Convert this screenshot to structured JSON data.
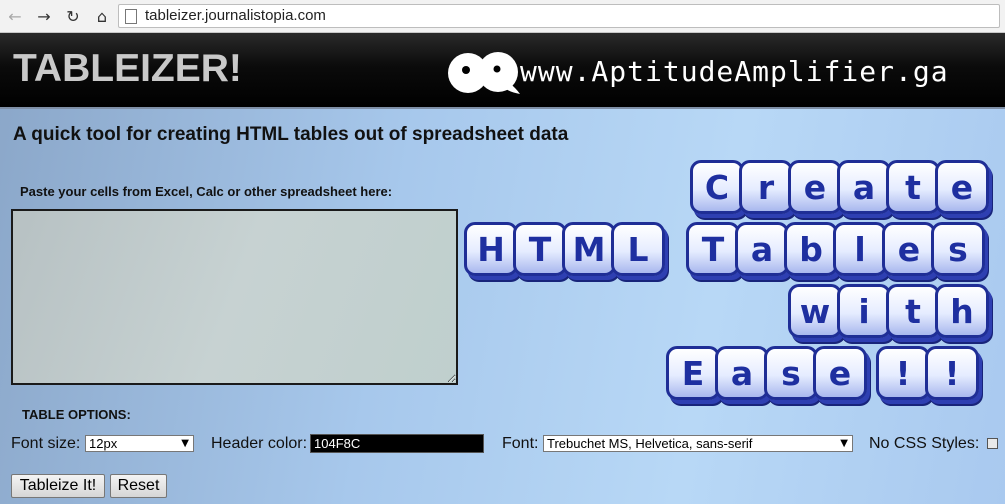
{
  "browser": {
    "url": "tableizer.journalistopia.com",
    "back_icon": "back-arrow-icon",
    "forward_icon": "forward-arrow-icon",
    "reload_icon": "reload-icon",
    "home_icon": "home-icon"
  },
  "header": {
    "title": "TABLEIZER!",
    "brand_url": "www.AptitudeAmplifier.ga",
    "logo_icon": "double-eye-logo-icon"
  },
  "main": {
    "heading": "A quick tool for creating HTML tables out of spreadsheet data",
    "paste_label": "Paste your cells from Excel, Calc or other spreadsheet here:",
    "paste_value": ""
  },
  "options": {
    "heading": "TABLE OPTIONS:",
    "font_size_label": "Font size:",
    "font_size_value": "12px",
    "header_color_label": "Header color:",
    "header_color_value": "104F8C",
    "font_label": "Font:",
    "font_value": "Trebuchet MS, Helvetica, sans-serif",
    "no_css_label": "No CSS Styles:",
    "no_css_checked": false
  },
  "buttons": {
    "tableize": "Tableize It!",
    "reset": "Reset"
  },
  "artwork": {
    "line1": [
      "C",
      "r",
      "e",
      "a",
      "t",
      "e"
    ],
    "line2a": [
      "H",
      "T",
      "M",
      "L"
    ],
    "line2b": [
      "T",
      "a",
      "b",
      "l",
      "e",
      "s"
    ],
    "line3": [
      "w",
      "i",
      "t",
      "h"
    ],
    "line4": [
      "E",
      "a",
      "s",
      "e",
      "!",
      "!"
    ]
  },
  "colors": {
    "header_bg": "#000000",
    "key_border": "#1f2e96",
    "key_text": "#1e2fa0",
    "page_bg": "#a7c8ec"
  }
}
